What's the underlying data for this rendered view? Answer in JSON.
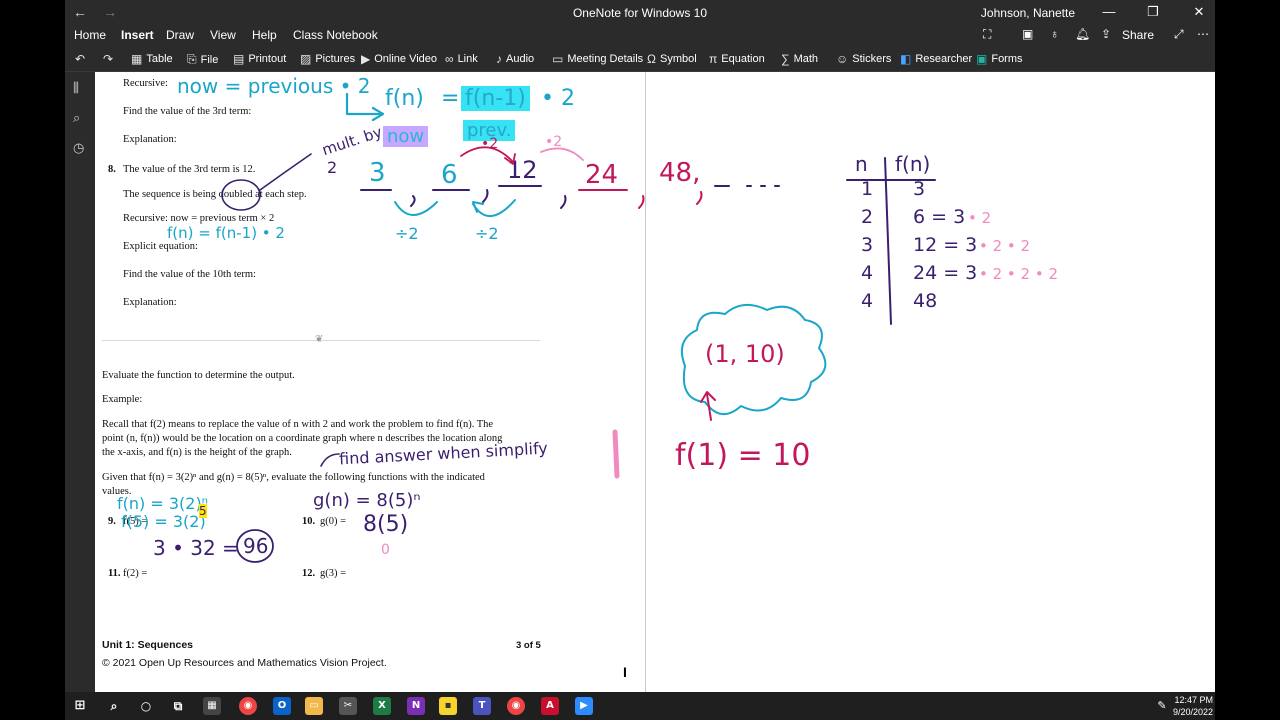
{
  "window": {
    "title": "OneNote for Windows 10",
    "user": "Johnson, Nanette",
    "back_icon": "back-arrow-icon",
    "forward_icon": "forward-arrow-icon"
  },
  "menu": {
    "tabs": [
      "Home",
      "Insert",
      "Draw",
      "View",
      "Help",
      "Class Notebook"
    ],
    "active": "Insert",
    "share_label": "Share"
  },
  "ribbon": {
    "items": [
      "Table",
      "File",
      "Printout",
      "Pictures",
      "Online Video",
      "Link",
      "Audio",
      "Meeting Details",
      "Symbol",
      "Equation",
      "Math",
      "Stickers",
      "Researcher",
      "Forms"
    ]
  },
  "doc": {
    "recursive_label": "Recursive:",
    "find3": "Find the value of the 3rd term:",
    "explanation1": "Explanation:",
    "q8_num": "8.",
    "q8_text": "The value of the 3rd term is 12.",
    "q8_doubled": "The sequence is being doubled at each step.",
    "q8_recursive": "Recursive: now = previous term × 2",
    "q8_explicit": "Explicit equation:",
    "q8_find10": "Find the value of the 10th term:",
    "explanation2": "Explanation:",
    "evaluate": "Evaluate the function to determine the output.",
    "example": "Example:",
    "recall1": "Recall that f(2) means to replace the value of n with 2 and work the problem to find f(n). The",
    "recall2": "point (n, f(n)) would be the location on a coordinate graph where n describes the location along",
    "recall3": "the x-axis, and f(n) is the height of the graph.",
    "given1": "Given that f(n) = 3(2)ⁿ and g(n) = 8(5)ⁿ, evaluate the following functions with the indicated",
    "given2": "values.",
    "q9": "9.",
    "q9_expr": "f(5) =",
    "q10": "10.",
    "q10_expr": "g(0) =",
    "q11": "11.",
    "q11_expr": "f(2) =",
    "q12": "12.",
    "q12_expr": "g(3) =",
    "footer_unit": "Unit 1: Sequences",
    "footer_page": "3 of 5",
    "footer_copy": "© 2021 Open Up Resources and Mathematics Vision Project."
  },
  "ink": {
    "now_prev": "now = previous • 2",
    "f_n": "f(n)",
    "eq": "=",
    "f_n_1": "f(n-1)",
    "times2": "• 2",
    "now": "now",
    "prev": "prev.",
    "mult_by": "mult. by",
    "mult_2": "2",
    "dot2a": "•2",
    "dot2b": "•2",
    "seq3": "3",
    "seq6": "6",
    "seq12": "12",
    "seq24": "24",
    "seq48": "48,",
    "div2a": "÷2",
    "div2b": "÷2",
    "fn_rec": "f(n) = f(n-1) • 2",
    "find_answer": "find answer when simplify",
    "f_n_9": "f(n) = 3(2)ⁿ",
    "f_5_9": "f(5) = 3(2)",
    "exp5": "5",
    "calc9": "3 • 32 =",
    "ans9": "96",
    "g_n": "g(n) = 8(5)ⁿ",
    "g_0": "8(5)",
    "zero": "0",
    "table_n": "n",
    "table_fn": "f(n)",
    "table_rows": [
      {
        "n": "1",
        "f": "3",
        "extra": ""
      },
      {
        "n": "2",
        "f": "6 = 3",
        "extra": "• 2"
      },
      {
        "n": "3",
        "f": "12 = 3",
        "extra": "• 2 • 2"
      },
      {
        "n": "4",
        "f": "24 = 3",
        "extra": "• 2 • 2 • 2"
      },
      {
        "n": "4",
        "f": "48",
        "extra": ""
      }
    ],
    "point": "(1, 10)",
    "f1": "f(1) = 10"
  },
  "taskbar": {
    "time": "12:47 PM",
    "date": "9/20/2022"
  },
  "colors": {
    "chrome": "#2b2b2b",
    "teal_ink": "#1aa6c9",
    "purple_ink": "#3a1f6e",
    "magenta_ink": "#c2185b",
    "pink_ink": "#f08ac0"
  }
}
